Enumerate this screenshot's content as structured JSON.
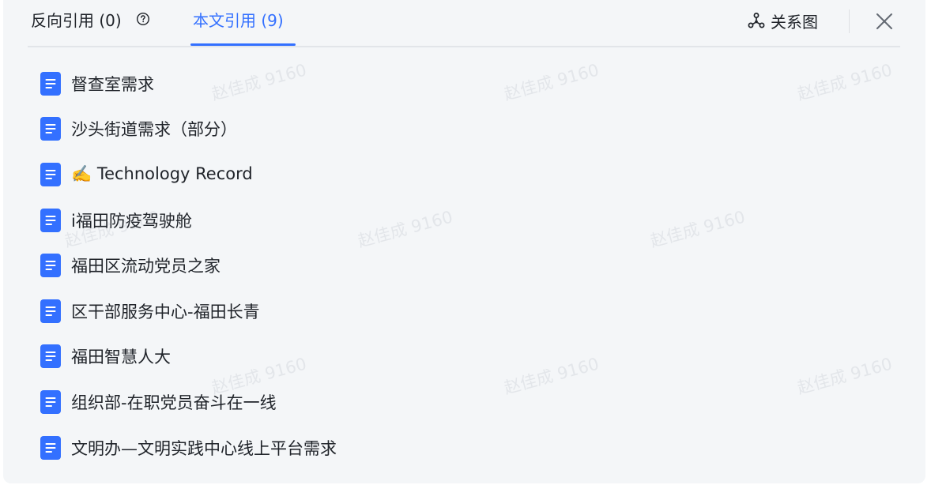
{
  "tabs": {
    "backref_label": "反向引用 (0)",
    "cited_label": "本文引用 (9)"
  },
  "header": {
    "graph_label": "关系图"
  },
  "watermark": {
    "text": "赵佳成 9160"
  },
  "documents": [
    {
      "title": "督查室需求"
    },
    {
      "title": "沙头街道需求（部分）"
    },
    {
      "title": "✍️ Technology Record"
    },
    {
      "title": "i福田防疫驾驶舱"
    },
    {
      "title": "福田区流动党员之家"
    },
    {
      "title": "区干部服务中心-福田长青"
    },
    {
      "title": "福田智慧人大"
    },
    {
      "title": "组织部-在职党员奋斗在一线"
    },
    {
      "title": "文明办—文明实践中心线上平台需求"
    }
  ],
  "colors": {
    "accent": "#3370ff",
    "doc_icon": "#3370ff",
    "text": "#1f2329",
    "panel_bg": "#f4f6f8"
  },
  "icons": {
    "help": "question-circle-icon",
    "graph": "relation-graph-icon",
    "close": "close-icon",
    "doc": "document-icon"
  }
}
